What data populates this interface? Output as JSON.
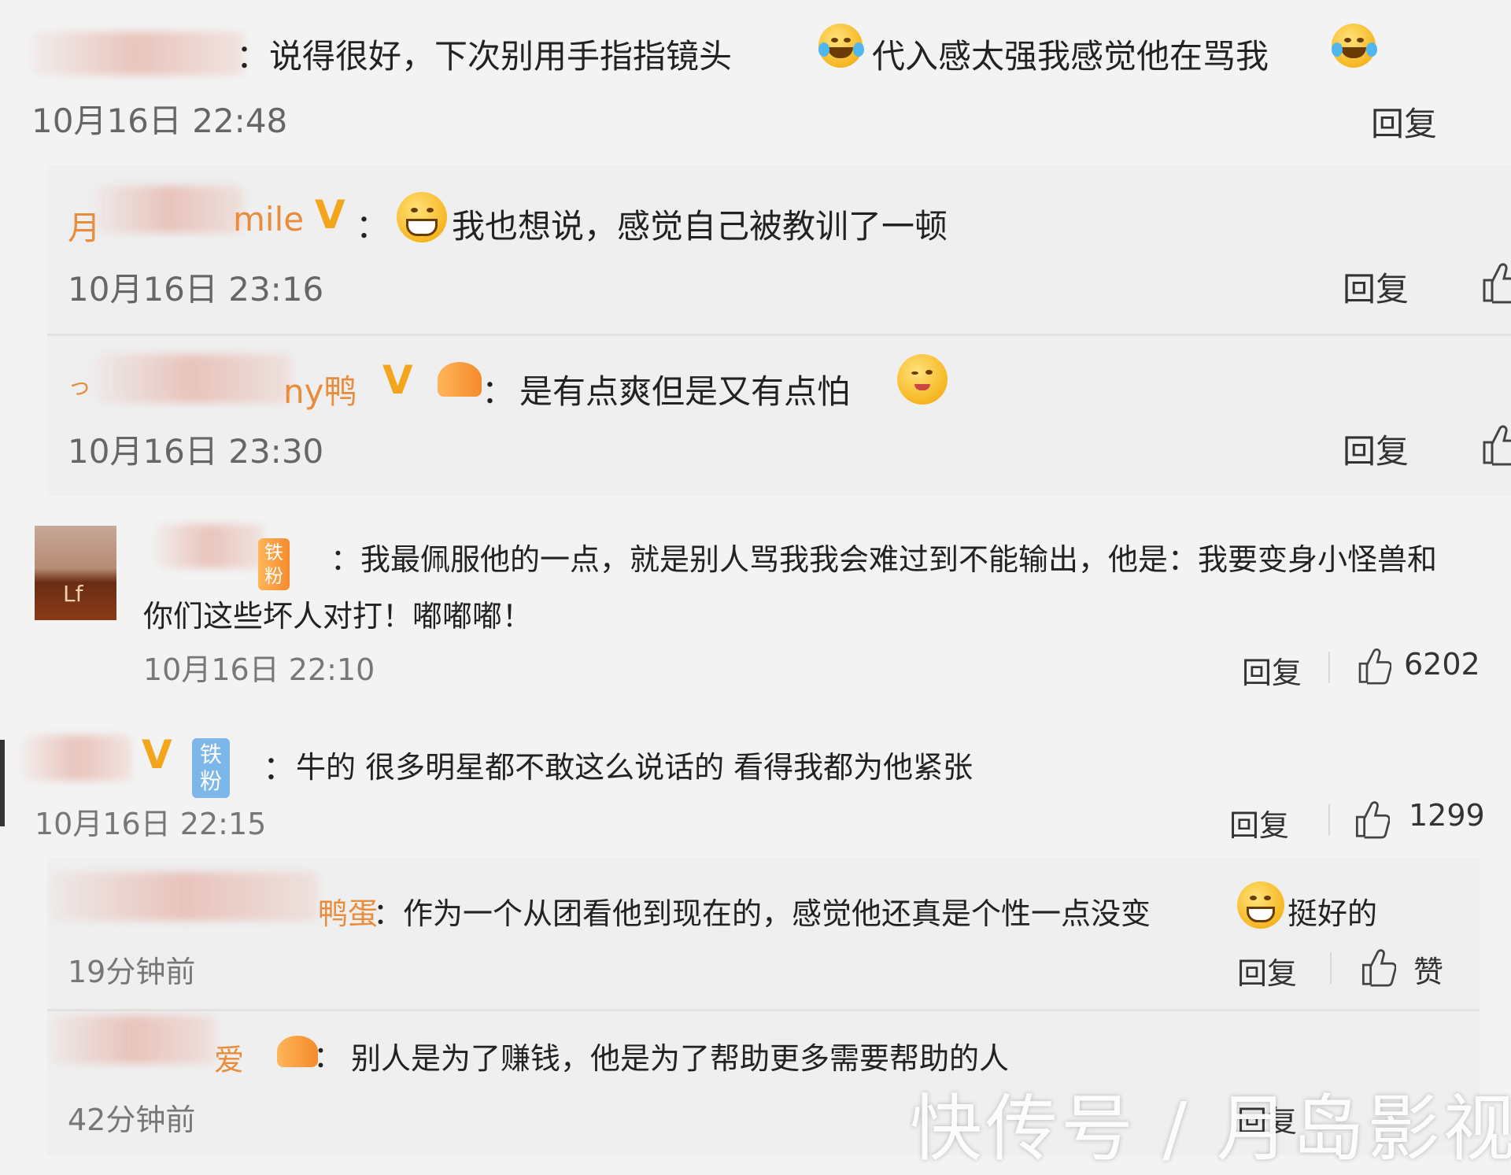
{
  "comments": [
    {
      "name_tail": "",
      "text_a": "：说得很好，下次别用手指指镜头",
      "text_b": "代入感太强我感觉他在骂我",
      "time": "10月16日 22:48",
      "reply": "回复"
    },
    {
      "name_head": "月",
      "name_tail": "mile",
      "badge": "V",
      "colon": "：",
      "text": "我也想说，感觉自己被教训了一顿",
      "time": "10月16日 23:16",
      "reply": "回复"
    },
    {
      "name_tail": "ny鸭",
      "badge": "V",
      "colon": "：",
      "text": "是有点爽但是又有点怕",
      "time": "10月16日 23:30",
      "reply": "回复"
    },
    {
      "fan_badge": "铁粉",
      "text_1": "：我最佩服他的一点，就是别人骂我我会难过到不能输出，他是：我要变身小怪兽和",
      "text_2": "你们这些坏人对打！嘟嘟嘟！",
      "time": "10月16日 22:10",
      "reply": "回复",
      "likes": "6202"
    },
    {
      "badge": "V",
      "fan_badge": "铁粉",
      "colon": "：",
      "text": "牛的 很多明星都不敢这么说话的 看得我都为他紧张",
      "time": "10月16日 22:15",
      "reply": "回复",
      "likes": "1299"
    },
    {
      "name_tail": "鸭蛋",
      "text_a": "：作为一个从团看他到现在的，感觉他还真是个性一点没变",
      "text_b": "挺好的",
      "time": "19分钟前",
      "reply": "回复",
      "likes": "赞"
    },
    {
      "name_tail": "爱",
      "colon": "：",
      "text": "别人是为了赚钱，他是为了帮助更多需要帮助的人",
      "time": "42分钟前",
      "reply": "回复"
    }
  ],
  "watermark": "快传号 / 月岛影视",
  "colors": {
    "vip_gold": "#f3a51d",
    "name_orange": "#e98c3c",
    "fan_blue": "#7db7ea"
  },
  "icons": [
    "laugh-cry-emoji",
    "grin-emoji",
    "wink-emoji",
    "thumbs-up-icon",
    "fan-badge-icon"
  ]
}
